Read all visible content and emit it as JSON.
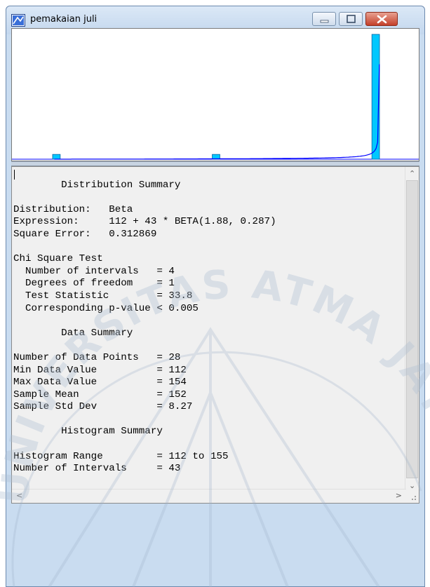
{
  "window": {
    "title": "pemakaian juli"
  },
  "report": {
    "lines": [
      "",
      "        Distribution Summary",
      "",
      "Distribution:   Beta",
      "Expression:     112 + 43 * BETA(1.88, 0.287)",
      "Square Error:   0.312869",
      "",
      "Chi Square Test",
      "  Number of intervals   = 4",
      "  Degrees of freedom    = 1",
      "  Test Statistic        = 33.8",
      "  Corresponding p-value < 0.005",
      "",
      "        Data Summary",
      "",
      "Number of Data Points   = 28",
      "Min Data Value          = 112",
      "Max Data Value          = 154",
      "Sample Mean             = 152",
      "Sample Std Dev          = 8.27",
      "",
      "        Histogram Summary",
      "",
      "Histogram Range         = 112 to 155",
      "Number of Intervals     = 43"
    ]
  },
  "histogram": {
    "type": "bar",
    "x_range": [
      112,
      155
    ],
    "bins": [
      {
        "x": 112,
        "frequency": 1
      },
      {
        "x": 133,
        "frequency": 1
      },
      {
        "x": 154,
        "frequency": 26
      }
    ],
    "fit": "Beta",
    "bar_color": "#00c8ff",
    "curve_color": "#0000ff"
  },
  "watermark": {
    "text": "UNIVERSITAS ATMA JAYA YOGYAKARTA"
  }
}
